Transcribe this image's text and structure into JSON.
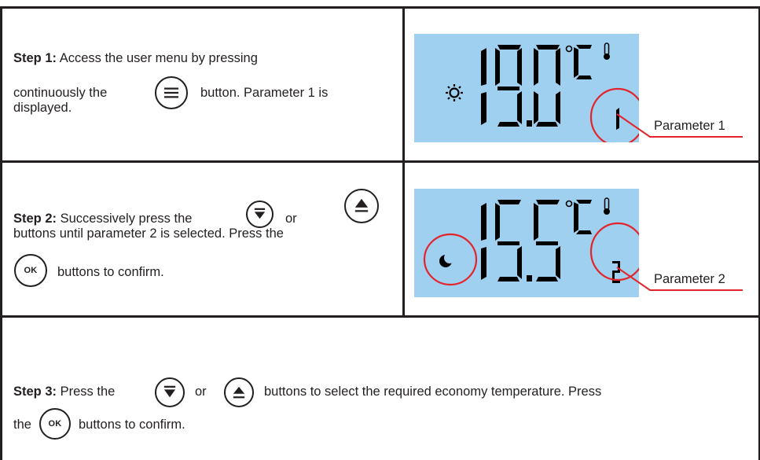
{
  "step1": {
    "title": "Step 1:",
    "line1": "Access the user menu by pressing",
    "line2a": "continuously the",
    "line2b": "button. Parameter 1 is",
    "line3": "displayed.",
    "menu_button_icon": "menu-lines-icon"
  },
  "display1": {
    "temperature": "19.0",
    "unit": "°C",
    "mode_icon": "sun-icon",
    "param_number": "1",
    "callout_label": "Parameter 1",
    "thermometer_icon": "thermometer-icon"
  },
  "step2": {
    "title": "Step 2:",
    "line1a": "Successively press the",
    "line1b": "or",
    "line2": "buttons until parameter 2 is selected. Press the",
    "line3": "buttons to confirm.",
    "ok_label": "OK",
    "down_icon": "arrow-down-icon",
    "up_icon": "arrow-up-icon"
  },
  "display2": {
    "temperature": "15.5",
    "unit": "°C",
    "mode_icon": "moon-icon",
    "param_number": "2",
    "callout_label": "Parameter 2",
    "thermometer_icon": "thermometer-icon"
  },
  "step3": {
    "title": "Step 3:",
    "line1a": "Press the",
    "line1b": "or",
    "line1c": "buttons to select the required economy temperature. Press",
    "line2a": "the",
    "line2b": "buttons to confirm.",
    "ok_label": "OK"
  },
  "colors": {
    "lcd_background": "#9fd0f0",
    "highlight_red": "#e3242b",
    "text": "#231f20"
  }
}
